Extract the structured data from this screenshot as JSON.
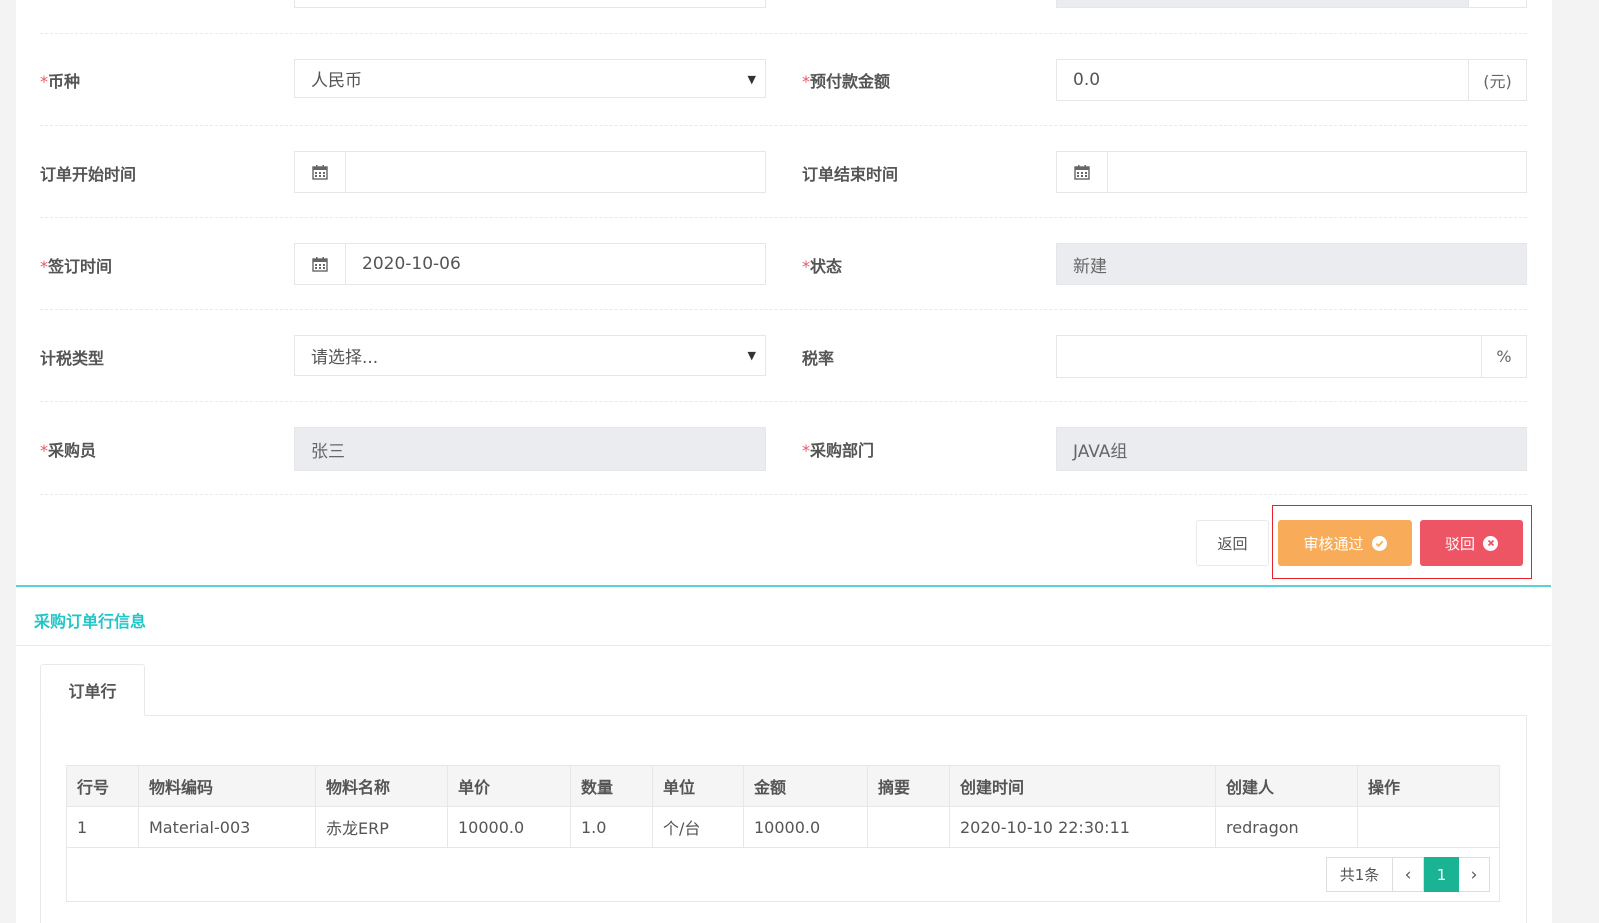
{
  "form": {
    "currency_label": "币种",
    "currency_value": "人民币",
    "prepay_label": "预付款金额",
    "prepay_value": "0.0",
    "prepay_unit": "(元)",
    "start_label": "订单开始时间",
    "start_value": "",
    "end_label": "订单结束时间",
    "end_value": "",
    "sign_label": "签订时间",
    "sign_value": "2020-10-06",
    "status_label": "状态",
    "status_value": "新建",
    "tax_type_label": "计税类型",
    "tax_type_value": "请选择...",
    "tax_rate_label": "税率",
    "tax_rate_value": "",
    "tax_rate_unit": "%",
    "buyer_label": "采购员",
    "buyer_value": "张三",
    "dept_label": "采购部门",
    "dept_value": "JAVA组",
    "required_mark": "*"
  },
  "actions": {
    "back_label": "返回",
    "approve_label": "审核通过",
    "reject_label": "驳回",
    "approve_color": "#f8ac59",
    "reject_color": "#ed5565",
    "highlight_color": "#e8212a"
  },
  "section": {
    "title": "采购订单行信息",
    "accent_color": "#1ab394",
    "tab_label": "订单行"
  },
  "table": {
    "columns": [
      "行号",
      "物料编码",
      "物料名称",
      "单价",
      "数量",
      "单位",
      "金额",
      "摘要",
      "创建时间",
      "创建人",
      "操作"
    ],
    "rows": [
      [
        "1",
        "Material-003",
        "赤龙ERP",
        "10000.0",
        "1.0",
        "个/台",
        "10000.0",
        "",
        "2020-10-10 22:30:11",
        "redragon",
        ""
      ]
    ]
  },
  "pagination": {
    "total": "共1条",
    "prev": "‹",
    "page": "1",
    "next": "›"
  },
  "icons": [
    "calendar-icon",
    "check-circle-icon",
    "times-circle-icon",
    "caret-down-icon"
  ]
}
